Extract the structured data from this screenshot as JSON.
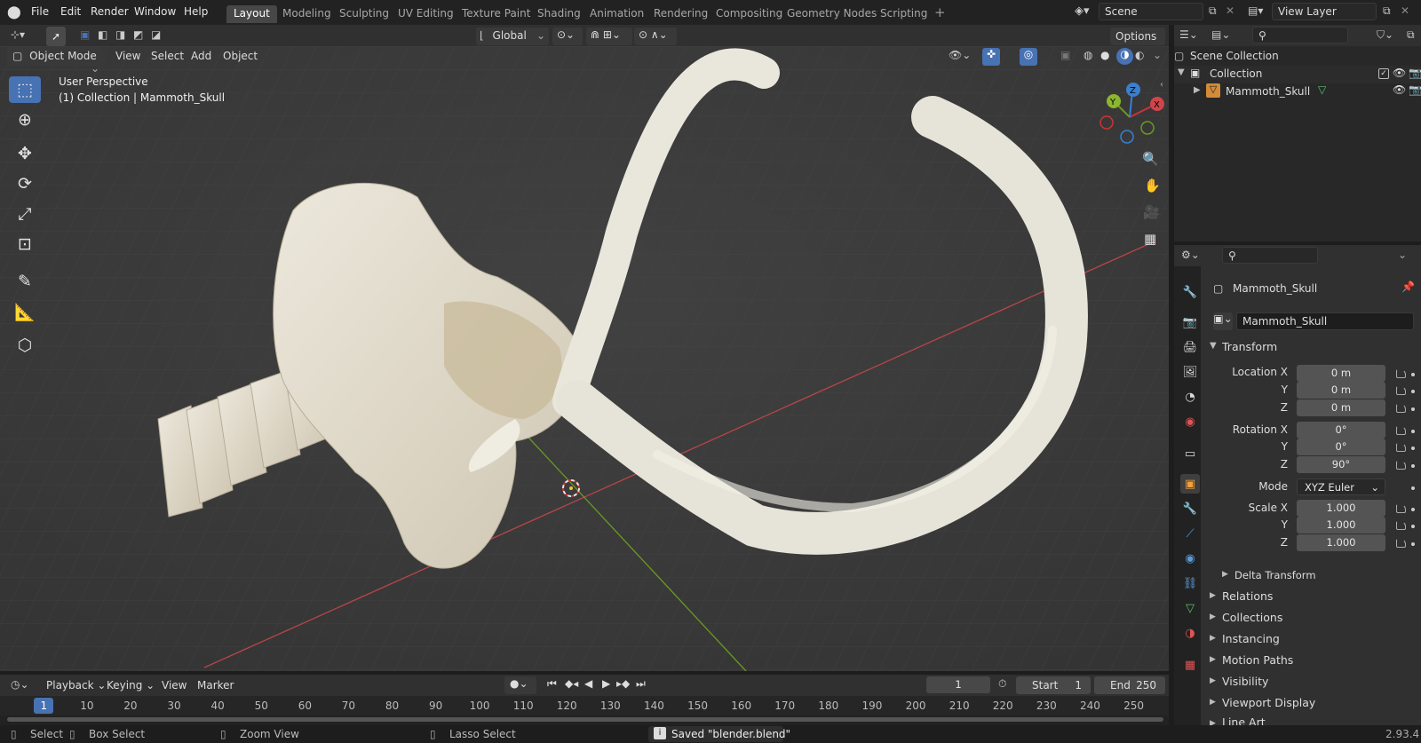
{
  "menus": [
    "File",
    "Edit",
    "Render",
    "Window",
    "Help"
  ],
  "workspaces": [
    "Layout",
    "Modeling",
    "Sculpting",
    "UV Editing",
    "Texture Paint",
    "Shading",
    "Animation",
    "Rendering",
    "Compositing",
    "Geometry Nodes",
    "Scripting"
  ],
  "scene": {
    "label": "Scene",
    "layer": "View Layer"
  },
  "toolbar_header": {
    "orientation": "Global",
    "options": "Options"
  },
  "viewport_header": {
    "mode": "Object Mode",
    "menus": [
      "View",
      "Select",
      "Add",
      "Object"
    ]
  },
  "viewport_overlay": {
    "perspective": "User Perspective",
    "collection_info": "(1) Collection | Mammoth_Skull"
  },
  "gizmo": {
    "x": "X",
    "y": "Y",
    "z": "Z"
  },
  "outliner": {
    "scene_collection": "Scene Collection",
    "collection": "Collection",
    "object": "Mammoth_Skull"
  },
  "properties": {
    "object_name": "Mammoth_Skull",
    "data_name": "Mammoth_Skull",
    "transform_title": "Transform",
    "location": {
      "label_x": "Location X",
      "label_y": "Y",
      "label_z": "Z",
      "x": "0 m",
      "y": "0 m",
      "z": "0 m"
    },
    "rotation": {
      "label_x": "Rotation X",
      "label_y": "Y",
      "label_z": "Z",
      "x": "0°",
      "y": "0°",
      "z": "90°"
    },
    "mode": {
      "label": "Mode",
      "value": "XYZ Euler"
    },
    "scale": {
      "label_x": "Scale X",
      "label_y": "Y",
      "label_z": "Z",
      "x": "1.000",
      "y": "1.000",
      "z": "1.000"
    },
    "panels": [
      "Delta Transform",
      "Relations",
      "Collections",
      "Instancing",
      "Motion Paths",
      "Visibility",
      "Viewport Display",
      "Line Art"
    ]
  },
  "timeline": {
    "menus": [
      "Playback",
      "Keying",
      "View",
      "Marker"
    ],
    "current_frame": "1",
    "start_label": "Start",
    "start": "1",
    "end_label": "End",
    "end": "250",
    "ticks": [
      "1",
      "10",
      "20",
      "30",
      "40",
      "50",
      "60",
      "70",
      "80",
      "90",
      "100",
      "110",
      "120",
      "130",
      "140",
      "150",
      "160",
      "170",
      "180",
      "190",
      "200",
      "210",
      "220",
      "230",
      "240",
      "250"
    ]
  },
  "status": {
    "select": "Select",
    "box_select": "Box Select",
    "zoom_view": "Zoom View",
    "lasso_select": "Lasso Select",
    "message": "Saved \"blender.blend\"",
    "version": "2.93.4"
  },
  "colors": {
    "accent": "#4772b3",
    "x_axis": "#c0464a",
    "y_axis": "#6a9a20"
  }
}
